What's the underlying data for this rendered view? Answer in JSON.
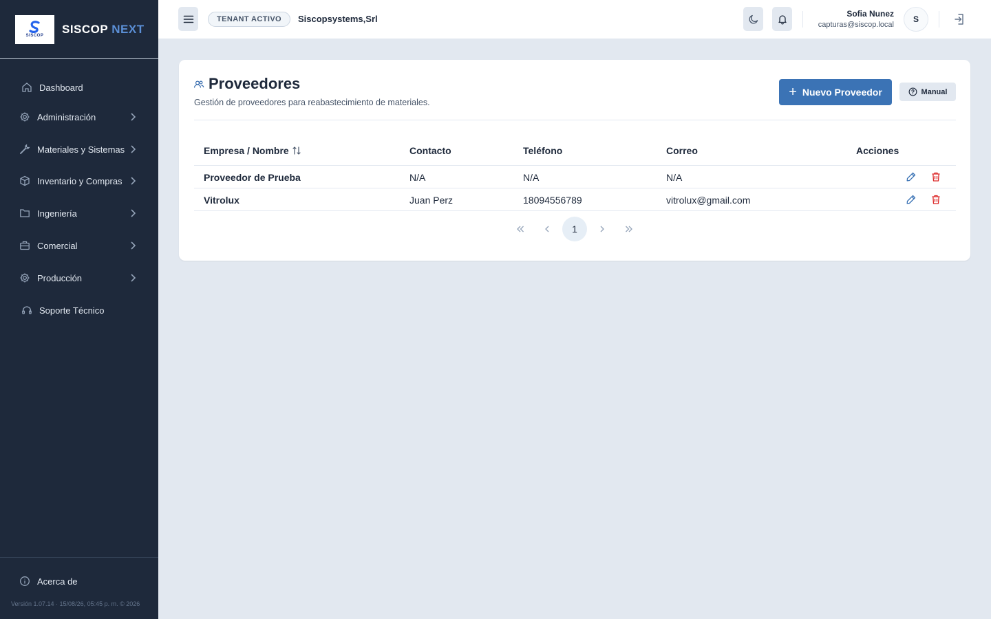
{
  "brand": {
    "logo_text": "SISCOP",
    "name_primary": "SISCOP",
    "name_accent": "NEXT"
  },
  "sidebar": {
    "items": [
      {
        "label": "Dashboard",
        "icon": "home-icon",
        "chevron": false
      },
      {
        "label": "Administración",
        "icon": "gear-icon",
        "chevron": true
      },
      {
        "label": "Materiales y Sistemas",
        "icon": "wrench-icon",
        "chevron": true
      },
      {
        "label": "Inventario y Compras",
        "icon": "box-icon",
        "chevron": true
      },
      {
        "label": "Ingeniería",
        "icon": "folder-icon",
        "chevron": true
      },
      {
        "label": "Comercial",
        "icon": "briefcase-icon",
        "chevron": true
      },
      {
        "label": "Producción",
        "icon": "gear-icon",
        "chevron": true
      },
      {
        "label": "Soporte Técnico",
        "icon": "headset-icon",
        "chevron": false
      }
    ],
    "about_label": "Acerca de",
    "version": "Versión 1.07.14 · 15/08/26, 05:45 p. m. © 2026"
  },
  "topbar": {
    "tenant_badge": "TENANT ACTIVO",
    "tenant_name": "Siscopsystems,Srl",
    "user_name": "Sofia Nunez",
    "user_email": "capturas@siscop.local",
    "avatar_initial": "S"
  },
  "page": {
    "title": "Proveedores",
    "subtitle": "Gestión de proveedores para reabastecimiento de materiales.",
    "new_button": "Nuevo Proveedor",
    "manual_button": "Manual"
  },
  "table": {
    "headers": {
      "name": "Empresa / Nombre",
      "contact": "Contacto",
      "phone": "Teléfono",
      "email": "Correo",
      "actions": "Acciones"
    },
    "rows": [
      {
        "name": "Proveedor de Prueba",
        "contact": "N/A",
        "phone": "N/A",
        "email": "N/A"
      },
      {
        "name": "Vitrolux",
        "contact": "Juan Perz",
        "phone": "18094556789",
        "email": "vitrolux@gmail.com"
      }
    ]
  },
  "pagination": {
    "current_page": "1"
  },
  "colors": {
    "sidebar_bg": "#1e293b",
    "accent": "#3b73b5",
    "danger": "#dc2626",
    "page_bg": "#e2e8f0"
  }
}
